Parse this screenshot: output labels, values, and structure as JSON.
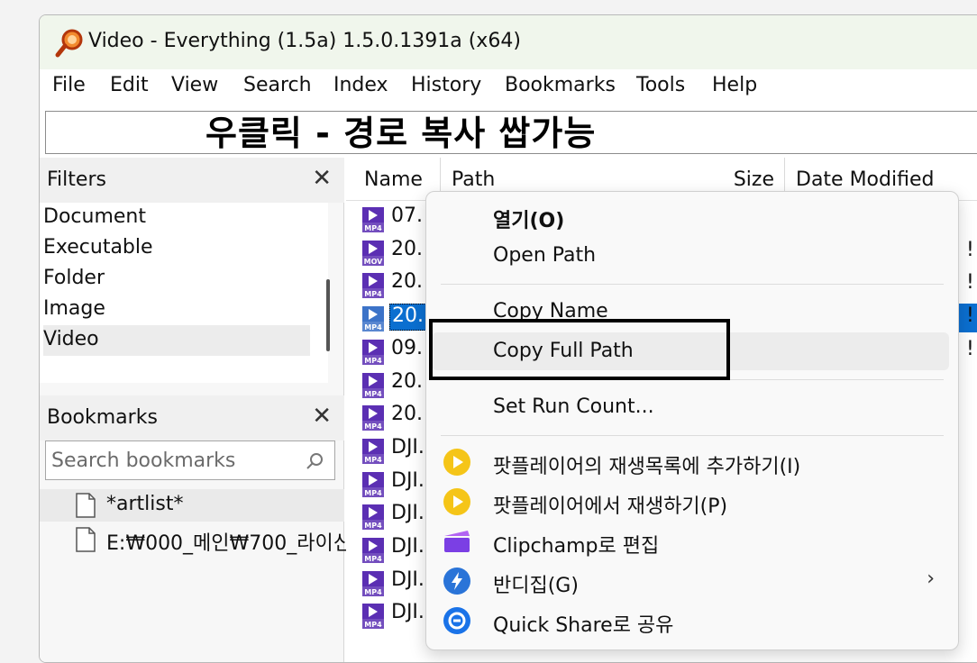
{
  "window": {
    "title": "Video - Everything (1.5a) 1.5.0.1391a (x64)"
  },
  "menu": [
    "File",
    "Edit",
    "View",
    "Search",
    "Index",
    "History",
    "Bookmarks",
    "Tools",
    "Help"
  ],
  "overlay_caption": "우클릭 - 경로 복사 쌉가능",
  "filters": {
    "title": "Filters",
    "items": [
      "Document",
      "Executable",
      "Folder",
      "Image",
      "Video"
    ],
    "selected": "Video"
  },
  "bookmarks": {
    "title": "Bookmarks",
    "search_placeholder": "Search bookmarks",
    "items": [
      "*artlist*",
      "E:₩000_메인₩700_라이신"
    ]
  },
  "columns": [
    "Name",
    "Path",
    "Size",
    "Date Modified"
  ],
  "rows": [
    {
      "name": "07.",
      "type": "MP4",
      "tail": ""
    },
    {
      "name": "20.",
      "type": "MOV",
      "tail": "!"
    },
    {
      "name": "20.",
      "type": "MP4",
      "tail": "!"
    },
    {
      "name": "20.",
      "type": "MP4",
      "tail": "!"
    },
    {
      "name": "09.",
      "type": "MP4",
      "tail": "!"
    },
    {
      "name": "20.",
      "type": "MP4",
      "tail": ""
    },
    {
      "name": "20.",
      "type": "MP4",
      "tail": ""
    },
    {
      "name": "DJI.",
      "type": "MP4",
      "tail": ""
    },
    {
      "name": "DJI.",
      "type": "MP4",
      "tail": ""
    },
    {
      "name": "DJI.",
      "type": "MP4",
      "tail": ""
    },
    {
      "name": "DJI.",
      "type": "MP4",
      "tail": ""
    },
    {
      "name": "DJI.",
      "type": "MP4",
      "tail": ""
    },
    {
      "name": "DJI.",
      "type": "MP4",
      "tail": ""
    }
  ],
  "context_menu": {
    "items": [
      {
        "label": "열기(O)",
        "bold": true
      },
      {
        "label": "Open Path"
      },
      {
        "label": "Copy Name"
      },
      {
        "label": "Copy Full Path"
      },
      {
        "label": "Set Run Count..."
      },
      {
        "label": "팟플레이어의 재생목록에 추가하기(I)",
        "icon": "potplayer-icon"
      },
      {
        "label": "팟플레이어에서 재생하기(P)",
        "icon": "potplayer-icon"
      },
      {
        "label": "Clipchamp로 편집",
        "icon": "clipchamp-icon"
      },
      {
        "label": "반디집(G)",
        "icon": "bandizip-icon"
      },
      {
        "label": "Quick Share로 공유",
        "icon": "quick-share-icon"
      }
    ]
  },
  "colors": {
    "selection": "#0b6fd0",
    "titlebar": "#f0f6ec",
    "mp4_icon": "#5b2fb3"
  }
}
